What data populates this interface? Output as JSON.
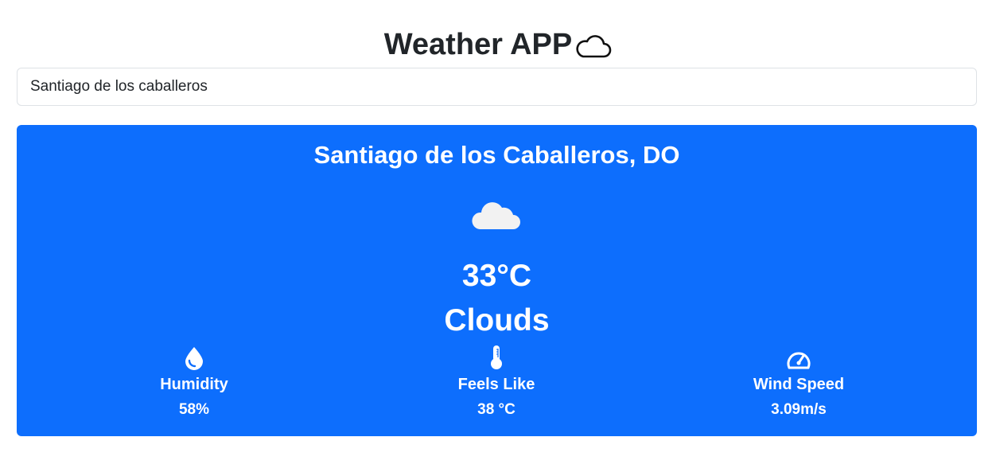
{
  "header": {
    "title": "Weather APP",
    "title_icon": "cloud-outline-icon"
  },
  "search": {
    "value": "Santiago de los caballeros"
  },
  "weather": {
    "location": "Santiago de los Caballeros, DO",
    "condition_icon": "cloud-icon",
    "temperature": "33°C",
    "condition": "Clouds",
    "stats": [
      {
        "icon": "droplet-icon",
        "label": "Humidity",
        "value": "58%"
      },
      {
        "icon": "thermometer-icon",
        "label": "Feels Like",
        "value": "38 °C"
      },
      {
        "icon": "speedometer-icon",
        "label": "Wind Speed",
        "value": "3.09m/s"
      }
    ]
  },
  "colors": {
    "card_background": "#0d6efd",
    "card_text": "#ffffff",
    "title_text": "#212529",
    "input_border": "#dee2e6"
  }
}
